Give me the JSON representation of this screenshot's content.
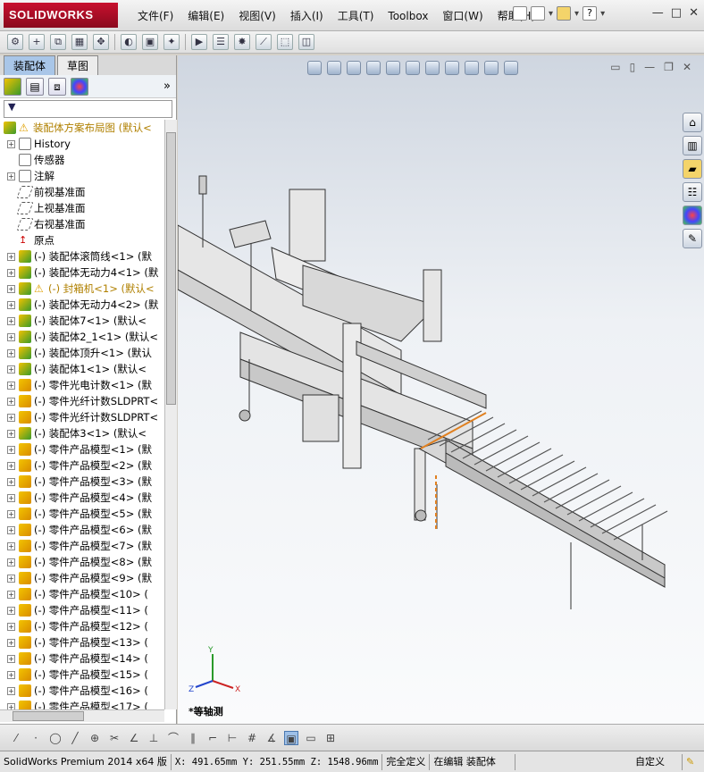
{
  "window": {
    "logo": "SOLIDWORKS",
    "menu": [
      "文件(F)",
      "编辑(E)",
      "视图(V)",
      "插入(I)",
      "工具(T)",
      "Toolbox",
      "窗口(W)",
      "帮助(H)"
    ],
    "controls": [
      "—",
      "□",
      "✕"
    ]
  },
  "panel": {
    "tabs": [
      "装配体",
      "草图"
    ],
    "active_tab": "装配体",
    "expand_label": "»",
    "filter_icon": "filter-icon"
  },
  "tree": {
    "root": "装配体方案布局图 (默认<",
    "items": [
      {
        "label": "History",
        "icon": "history",
        "exp": true
      },
      {
        "label": "传感器",
        "icon": "sensor",
        "exp": false
      },
      {
        "label": "注解",
        "icon": "annotation",
        "exp": true
      },
      {
        "label": "前视基准面",
        "icon": "plane",
        "exp": false
      },
      {
        "label": "上视基准面",
        "icon": "plane",
        "exp": false
      },
      {
        "label": "右视基准面",
        "icon": "plane",
        "exp": false
      },
      {
        "label": "原点",
        "icon": "origin",
        "exp": false
      },
      {
        "label": "(-) 装配体滚筒线<1> (默",
        "icon": "asm",
        "exp": true
      },
      {
        "label": "(-) 装配体无动力4<1> (默",
        "icon": "asm",
        "exp": true
      },
      {
        "label": "(-) 封箱机<1> (默认<",
        "icon": "asm-warn",
        "exp": true
      },
      {
        "label": "(-) 装配体无动力4<2> (默",
        "icon": "asm",
        "exp": true
      },
      {
        "label": "(-) 装配体7<1> (默认<",
        "icon": "asm",
        "exp": true
      },
      {
        "label": "(-) 装配体2_1<1> (默认<",
        "icon": "asm",
        "exp": true
      },
      {
        "label": "(-) 装配体顶升<1> (默认",
        "icon": "asm",
        "exp": true
      },
      {
        "label": "(-) 装配体1<1> (默认<",
        "icon": "asm",
        "exp": true
      },
      {
        "label": "(-) 零件光电计数<1> (默",
        "icon": "part",
        "exp": true
      },
      {
        "label": "(-) 零件光纤计数SLDPRT<",
        "icon": "part",
        "exp": true
      },
      {
        "label": "(-) 零件光纤计数SLDPRT<",
        "icon": "part",
        "exp": true
      },
      {
        "label": "(-) 装配体3<1> (默认<",
        "icon": "asm",
        "exp": true
      },
      {
        "label": "(-) 零件产品模型<1> (默",
        "icon": "part",
        "exp": true
      },
      {
        "label": "(-) 零件产品模型<2> (默",
        "icon": "part",
        "exp": true
      },
      {
        "label": "(-) 零件产品模型<3> (默",
        "icon": "part",
        "exp": true
      },
      {
        "label": "(-) 零件产品模型<4> (默",
        "icon": "part",
        "exp": true
      },
      {
        "label": "(-) 零件产品模型<5> (默",
        "icon": "part",
        "exp": true
      },
      {
        "label": "(-) 零件产品模型<6> (默",
        "icon": "part",
        "exp": true
      },
      {
        "label": "(-) 零件产品模型<7> (默",
        "icon": "part",
        "exp": true
      },
      {
        "label": "(-) 零件产品模型<8> (默",
        "icon": "part",
        "exp": true
      },
      {
        "label": "(-) 零件产品模型<9> (默",
        "icon": "part",
        "exp": true
      },
      {
        "label": "(-) 零件产品模型<10> (",
        "icon": "part",
        "exp": true
      },
      {
        "label": "(-) 零件产品模型<11> (",
        "icon": "part",
        "exp": true
      },
      {
        "label": "(-) 零件产品模型<12> (",
        "icon": "part",
        "exp": true
      },
      {
        "label": "(-) 零件产品模型<13> (",
        "icon": "part",
        "exp": true
      },
      {
        "label": "(-) 零件产品模型<14> (",
        "icon": "part",
        "exp": true
      },
      {
        "label": "(-) 零件产品模型<15> (",
        "icon": "part",
        "exp": true
      },
      {
        "label": "(-) 零件产品模型<16> (",
        "icon": "part",
        "exp": true
      },
      {
        "label": "(-) 零件产品模型<17> (",
        "icon": "part",
        "exp": true
      }
    ]
  },
  "viewport": {
    "view_label": "*等轴测",
    "triad": {
      "x": "X",
      "y": "Y",
      "z": "Z"
    }
  },
  "status": {
    "version": "SolidWorks Premium 2014 x64 版",
    "coords": "X: 491.65mm Y: 251.55mm Z: 1548.96mm",
    "state": "完全定义",
    "editing": "在编辑 装配体",
    "units": "自定义"
  }
}
